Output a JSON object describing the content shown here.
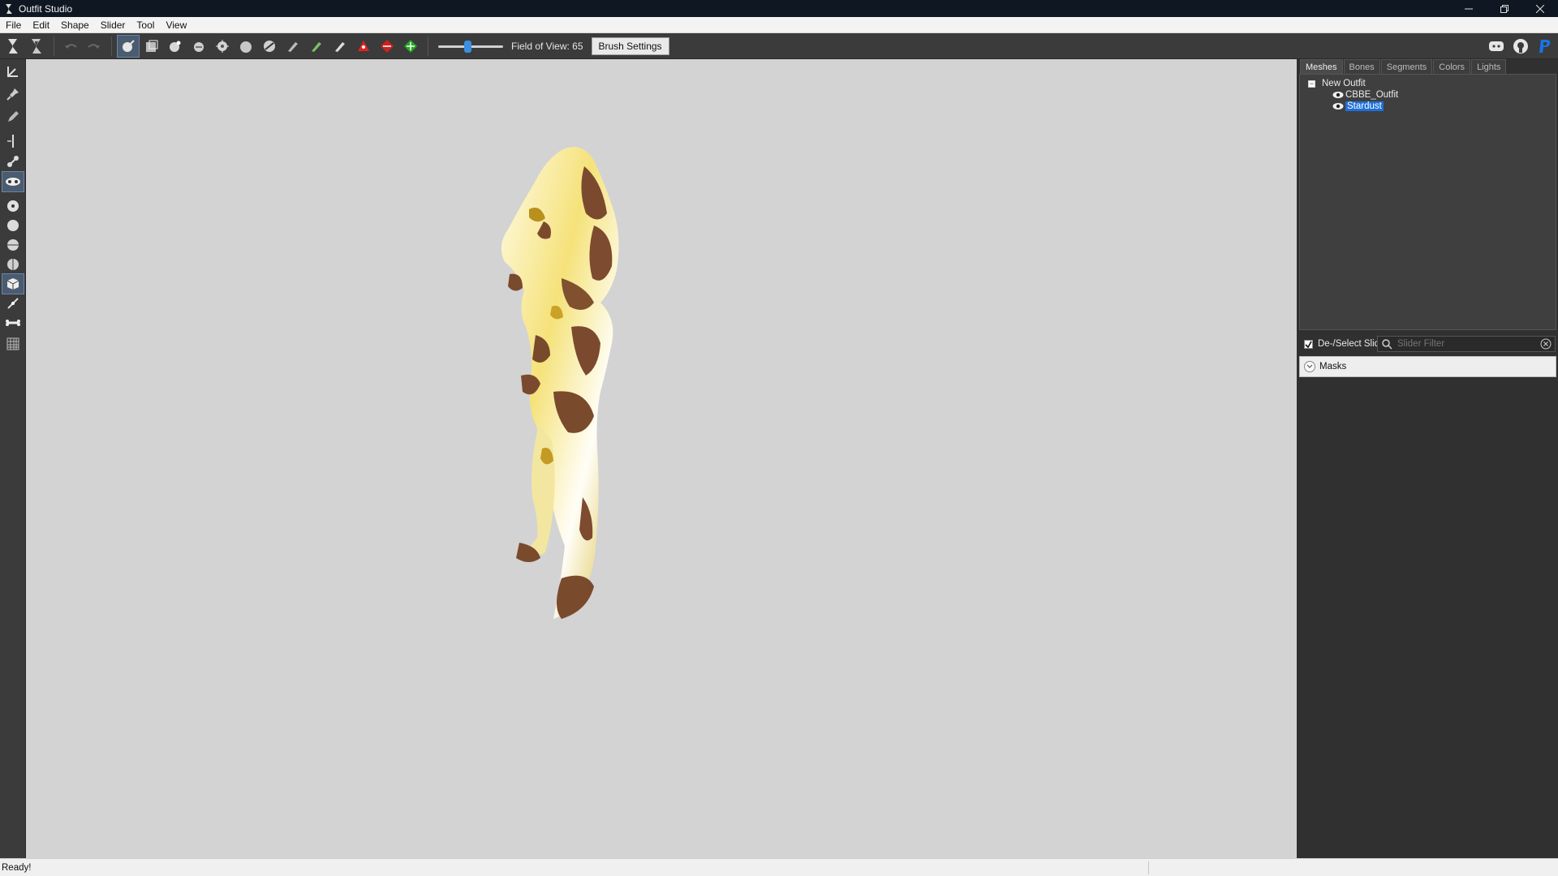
{
  "window": {
    "title": "Outfit Studio"
  },
  "menu": [
    "File",
    "Edit",
    "Shape",
    "Slider",
    "Tool",
    "View"
  ],
  "toolbar": {
    "fov_label": "Field of View: 65",
    "fov_level": 0.45,
    "brush_settings_label": "Brush Settings",
    "accent": "#3a8fe0"
  },
  "tabs": [
    "Meshes",
    "Bones",
    "Segments",
    "Colors",
    "Lights"
  ],
  "active_tab": "Meshes",
  "tree": {
    "root": "New Outfit",
    "root_expander": "−",
    "items": [
      "CBBE_Outfit",
      "Stardust"
    ],
    "selected": "Stardust"
  },
  "sliders": {
    "deselect_label": "De-/Select Sliders",
    "filter_placeholder": "Slider Filter",
    "masks_label": "Masks"
  },
  "status": {
    "text": "Ready!"
  }
}
